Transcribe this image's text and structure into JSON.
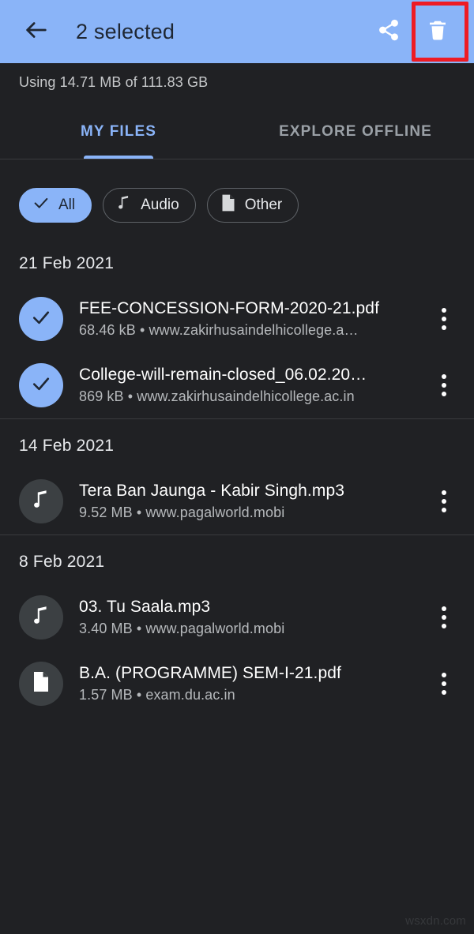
{
  "appbar": {
    "back_icon": "arrow-back-icon",
    "title": "2 selected",
    "share_icon": "share-icon",
    "delete_icon": "delete-trash-icon",
    "bg_color": "#8ab4f8",
    "highlight_color": "#ee1b24"
  },
  "storage": {
    "text": "Using 14.71 MB of 111.83 GB"
  },
  "tabs": [
    {
      "label": "MY FILES",
      "active": true
    },
    {
      "label": "EXPLORE OFFLINE",
      "active": false
    }
  ],
  "chips": [
    {
      "label": "All",
      "icon": "check-icon",
      "selected": true
    },
    {
      "label": "Audio",
      "icon": "music-note-icon",
      "selected": false
    },
    {
      "label": "Other",
      "icon": "document-icon",
      "selected": false
    }
  ],
  "sections": [
    {
      "date": "21 Feb 2021",
      "items": [
        {
          "name": "FEE-CONCESSION-FORM-2020-21.pdf",
          "meta": "68.46 kB • www.zakirhusaindelhicollege.a…",
          "icon": "check-icon",
          "selected": true
        },
        {
          "name": "College-will-remain-closed_06.02.20…",
          "meta": "869 kB • www.zakirhusaindelhicollege.ac.in",
          "icon": "check-icon",
          "selected": true
        }
      ]
    },
    {
      "date": "14 Feb 2021",
      "items": [
        {
          "name": "Tera Ban Jaunga - Kabir Singh.mp3",
          "meta": "9.52 MB • www.pagalworld.mobi",
          "icon": "music-note-icon",
          "selected": false
        }
      ]
    },
    {
      "date": "8 Feb 2021",
      "items": [
        {
          "name": "03. Tu Saala.mp3",
          "meta": "3.40 MB • www.pagalworld.mobi",
          "icon": "music-note-icon",
          "selected": false
        },
        {
          "name": "B.A. (PROGRAMME) SEM-I-21.pdf",
          "meta": "1.57 MB • exam.du.ac.in",
          "icon": "document-icon",
          "selected": false
        }
      ]
    }
  ],
  "overflow_icon": "more-vertical-icon",
  "watermark": "wsxdn.com"
}
